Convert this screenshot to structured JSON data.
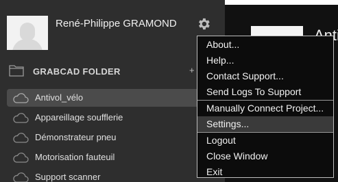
{
  "profile": {
    "name": "René-Philippe GRAMOND",
    "avatar_icon": "user-avatar-placeholder",
    "settings_icon": "gear-icon"
  },
  "folders": {
    "header": "GRABCAD FOLDER",
    "add_label": "+",
    "items": [
      {
        "label": "Antivol_vélo",
        "selected": true
      },
      {
        "label": "Appareillage soufflerie",
        "selected": false
      },
      {
        "label": "Démonstrateur pneu",
        "selected": false
      },
      {
        "label": "Motorisation fauteuil",
        "selected": false
      },
      {
        "label": "Support scanner",
        "selected": false
      }
    ]
  },
  "detail": {
    "title": "Anti"
  },
  "menu": {
    "items": [
      {
        "label": "About..."
      },
      {
        "label": "Help..."
      },
      {
        "label": "Contact Support..."
      },
      {
        "label": "Send Logs To Support"
      },
      {
        "label": "Manually Connect Project..."
      },
      {
        "label": "Settings...",
        "hover": true
      },
      {
        "label": "Logout"
      },
      {
        "label": "Close Window"
      },
      {
        "label": "Exit"
      }
    ]
  },
  "colors": {
    "panel_bg": "#2e2e2e",
    "menu_bg": "#0c0c0c",
    "menu_hover": "#3a3a3a",
    "selected_row": "#4b4b4b"
  }
}
